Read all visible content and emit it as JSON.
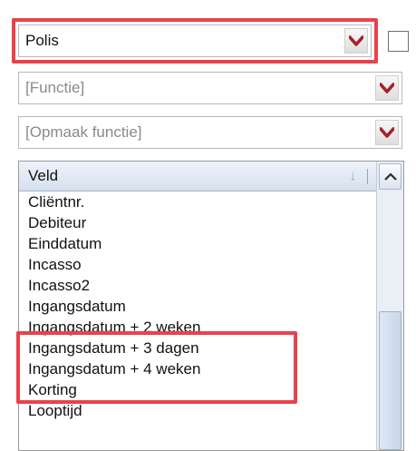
{
  "colors": {
    "highlight": "#e8434a",
    "dropdown_arrow": "#a4232a",
    "placeholder_text": "#8a8a8a"
  },
  "dropdowns": {
    "polis": {
      "value": "Polis",
      "icon": "chevron-down-icon"
    },
    "functie": {
      "placeholder": "[Functie]",
      "icon": "chevron-down-icon"
    },
    "opmaak": {
      "placeholder": "[Opmaak functie]",
      "icon": "chevron-down-icon"
    }
  },
  "checkbox": {
    "checked": false
  },
  "field_list": {
    "header": "Veld",
    "sort_icon": "sort-down-icon",
    "items": [
      "Cliëntnr.",
      "Debiteur",
      "Einddatum",
      "Incasso",
      "Incasso2",
      "Ingangsdatum",
      "Ingangsdatum + 2 weken",
      "Ingangsdatum + 3 dagen",
      "Ingangsdatum + 4 weken",
      "Korting",
      "Looptijd"
    ],
    "highlighted_items": [
      "Ingangsdatum + 2 weken",
      "Ingangsdatum + 3 dagen",
      "Ingangsdatum + 4 weken"
    ]
  },
  "scrollbar": {
    "up_icon": "chevron-up-icon"
  }
}
